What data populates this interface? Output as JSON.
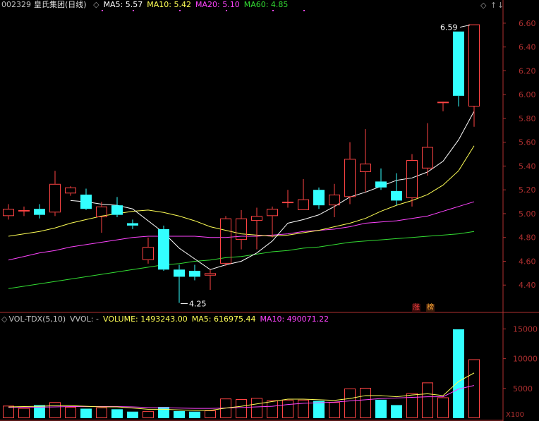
{
  "header": {
    "stock_code": "002329",
    "stock_name": "皇氏集团(日线)",
    "ma_labels": [
      {
        "label": "MA5: 5.57",
        "color": "#ffffff"
      },
      {
        "label": "MA10: 5.42",
        "color": "#ffff55"
      },
      {
        "label": "MA20: 5.10",
        "color": "#ff44ff"
      },
      {
        "label": "MA60: 4.85",
        "color": "#33dd33"
      }
    ],
    "controls": {
      "diamond": "◇",
      "up": "↑",
      "down": "↓"
    }
  },
  "volume_header": {
    "indicator": "VOL-TDX(5,10)",
    "vvol": "VVOL: -",
    "volume": "VOLUME: 1493243.00",
    "ma5": "MA5: 616975.44",
    "ma10": "MA10: 490071.22",
    "multiplier": "X100"
  },
  "annotations": {
    "high_label": "6.59",
    "low_label": "4.25",
    "badge_zhang": "涨",
    "badge_bang": "榜"
  },
  "colors": {
    "up": "#ff4444",
    "down": "#33ffff",
    "ma5": "#ffffff",
    "ma10": "#ffff55",
    "ma20": "#ff44ff",
    "ma60": "#33dd33",
    "axis": "#b03030",
    "grid": "#7a1a1a"
  },
  "chart_data": [
    {
      "type": "candlestick",
      "title": "002329 皇氏集团(日线)",
      "ylim": [
        4.2,
        6.7
      ],
      "y_ticks": [
        "6.60",
        "6.40",
        "6.20",
        "6.00",
        "5.80",
        "5.60",
        "5.40",
        "5.20",
        "5.00",
        "4.80",
        "4.60",
        "4.40"
      ],
      "candles": [
        {
          "o": 4.98,
          "h": 5.08,
          "l": 4.95,
          "c": 5.04
        },
        {
          "o": 5.02,
          "h": 5.06,
          "l": 4.98,
          "c": 5.03
        },
        {
          "o": 5.04,
          "h": 5.08,
          "l": 4.96,
          "c": 4.99
        },
        {
          "o": 5.01,
          "h": 5.36,
          "l": 4.98,
          "c": 5.25
        },
        {
          "o": 5.17,
          "h": 5.23,
          "l": 5.15,
          "c": 5.22
        },
        {
          "o": 5.16,
          "h": 5.21,
          "l": 5.03,
          "c": 5.04
        },
        {
          "o": 4.97,
          "h": 5.1,
          "l": 4.84,
          "c": 5.06
        },
        {
          "o": 5.07,
          "h": 5.14,
          "l": 4.97,
          "c": 4.99
        },
        {
          "o": 4.92,
          "h": 4.95,
          "l": 4.87,
          "c": 4.9
        },
        {
          "o": 4.61,
          "h": 4.8,
          "l": 4.58,
          "c": 4.72
        },
        {
          "o": 4.87,
          "h": 4.9,
          "l": 4.52,
          "c": 4.53
        },
        {
          "o": 4.53,
          "h": 4.57,
          "l": 4.25,
          "c": 4.47
        },
        {
          "o": 4.52,
          "h": 4.57,
          "l": 4.44,
          "c": 4.47
        },
        {
          "o": 4.48,
          "h": 4.53,
          "l": 4.36,
          "c": 4.5
        },
        {
          "o": 4.58,
          "h": 4.98,
          "l": 4.56,
          "c": 4.96
        },
        {
          "o": 4.78,
          "h": 5.03,
          "l": 4.7,
          "c": 4.96
        },
        {
          "o": 4.94,
          "h": 5.05,
          "l": 4.7,
          "c": 4.98
        },
        {
          "o": 4.98,
          "h": 5.06,
          "l": 4.8,
          "c": 5.04
        },
        {
          "o": 5.1,
          "h": 5.2,
          "l": 5.05,
          "c": 5.1
        },
        {
          "o": 5.03,
          "h": 5.29,
          "l": 5.03,
          "c": 5.12
        },
        {
          "o": 5.2,
          "h": 5.22,
          "l": 5.04,
          "c": 5.07
        },
        {
          "o": 5.07,
          "h": 5.25,
          "l": 4.97,
          "c": 5.16
        },
        {
          "o": 5.14,
          "h": 5.6,
          "l": 5.08,
          "c": 5.46
        },
        {
          "o": 5.35,
          "h": 5.71,
          "l": 5.18,
          "c": 5.42
        },
        {
          "o": 5.27,
          "h": 5.38,
          "l": 5.2,
          "c": 5.22
        },
        {
          "o": 5.19,
          "h": 5.34,
          "l": 5.07,
          "c": 5.11
        },
        {
          "o": 5.13,
          "h": 5.5,
          "l": 5.06,
          "c": 5.45
        },
        {
          "o": 5.38,
          "h": 5.76,
          "l": 5.32,
          "c": 5.56
        },
        {
          "o": 5.94,
          "h": 5.94,
          "l": 5.86,
          "c": 5.94
        },
        {
          "o": 6.53,
          "h": 6.53,
          "l": 5.9,
          "c": 5.99
        },
        {
          "o": 5.9,
          "h": 6.59,
          "l": 5.73,
          "c": 6.59
        }
      ],
      "ma5": [
        null,
        null,
        null,
        null,
        5.11,
        5.1,
        5.08,
        5.07,
        5.04,
        4.94,
        4.84,
        4.71,
        4.62,
        4.53,
        4.57,
        4.6,
        4.67,
        4.77,
        4.92,
        4.95,
        4.99,
        5.06,
        5.14,
        5.18,
        5.23,
        5.28,
        5.3,
        5.35,
        5.44,
        5.62,
        5.86
      ],
      "ma10": [
        4.81,
        4.83,
        4.85,
        4.88,
        4.92,
        4.95,
        4.98,
        5.0,
        5.02,
        5.03,
        5.01,
        4.98,
        4.94,
        4.89,
        4.86,
        4.83,
        4.82,
        4.81,
        4.82,
        4.84,
        4.86,
        4.89,
        4.92,
        4.96,
        5.02,
        5.07,
        5.11,
        5.16,
        5.24,
        5.36,
        5.57
      ],
      "ma20": [
        4.61,
        4.64,
        4.67,
        4.69,
        4.72,
        4.74,
        4.76,
        4.78,
        4.8,
        4.81,
        4.81,
        4.81,
        4.81,
        4.8,
        4.8,
        4.81,
        4.81,
        4.82,
        4.83,
        4.85,
        4.86,
        4.87,
        4.89,
        4.92,
        4.93,
        4.94,
        4.96,
        4.98,
        5.02,
        5.06,
        5.1
      ],
      "ma60": [
        4.37,
        4.39,
        4.41,
        4.43,
        4.45,
        4.47,
        4.49,
        4.51,
        4.53,
        4.55,
        4.57,
        4.58,
        4.6,
        4.61,
        4.63,
        4.64,
        4.66,
        4.68,
        4.69,
        4.71,
        4.72,
        4.74,
        4.76,
        4.77,
        4.78,
        4.79,
        4.8,
        4.81,
        4.82,
        4.83,
        4.85
      ]
    },
    {
      "type": "bar",
      "title": "VOL-TDX(5,10)",
      "ylim": [
        0,
        16000
      ],
      "y_ticks": [
        "15000",
        "10000",
        "5000"
      ],
      "unit": "X100",
      "values": [
        2100,
        1700,
        2200,
        2700,
        1900,
        1600,
        1800,
        1500,
        1100,
        1200,
        1900,
        1200,
        1100,
        1300,
        3300,
        3200,
        3400,
        3000,
        3100,
        3100,
        2900,
        2700,
        5000,
        5100,
        3100,
        2200,
        4200,
        6000,
        3500,
        14932,
        9900
      ],
      "ma5": [
        1900,
        1950,
        2000,
        2100,
        2100,
        2000,
        1900,
        1900,
        1700,
        1500,
        1500,
        1400,
        1300,
        1300,
        1700,
        2000,
        2400,
        2800,
        3200,
        3200,
        3100,
        3000,
        3300,
        3800,
        3800,
        3600,
        3900,
        4100,
        3800,
        6170,
        7600
      ],
      "ma10": [
        1800,
        1850,
        1850,
        1900,
        1950,
        1950,
        1950,
        1950,
        1900,
        1800,
        1750,
        1700,
        1650,
        1650,
        1700,
        1800,
        1900,
        2000,
        2300,
        2500,
        2600,
        2700,
        2900,
        3100,
        3300,
        3400,
        3500,
        3600,
        3600,
        4900,
        5500
      ]
    }
  ]
}
